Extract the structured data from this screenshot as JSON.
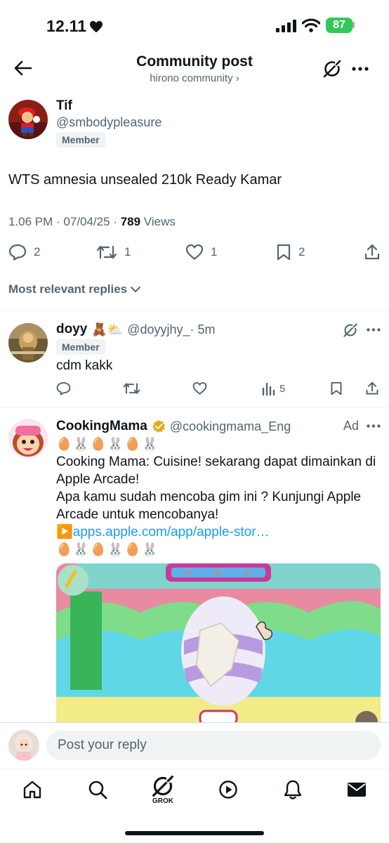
{
  "status_bar": {
    "time": "12.11",
    "battery": "87"
  },
  "header": {
    "title": "Community post",
    "subtitle": "hirono community ›"
  },
  "post": {
    "name": "Tif",
    "handle": "@smbodypleasure",
    "badge": "Member",
    "text": "WTS amnesia unsealed 210k Ready Kamar",
    "meta_time": "1.06 PM · 07/04/25 · ",
    "views_count": "789",
    "views_label": " Views",
    "replies": "2",
    "reposts": "1",
    "likes": "1",
    "bookmarks": "2"
  },
  "sort_label": "Most relevant replies",
  "reply": {
    "name": "doyy",
    "name_emoji": "🧸⛅",
    "handle": "@doyyjhy_",
    "time": " · 5m",
    "badge": "Member",
    "text": "cdm kakk",
    "views": "5"
  },
  "ad": {
    "name": "CookingMama",
    "handle": "@cookingmama_Eng",
    "ad_label": "Ad",
    "emoji_row": "🥚🐰🥚🐰🥚🐰",
    "line1": "Cooking Mama: Cuisine! sekarang dapat dimainkan di Apple Arcade!",
    "line2": "Apa kamu sudah mencoba gim ini ? Kunjungi Apple Arcade untuk mencobanya!",
    "link_emoji": "▶️",
    "link": "apps.apple.com/app/apple-stor…",
    "emoji_row2": "🥚🐰🥚🐰🥚🐰"
  },
  "reply_box": {
    "placeholder": "Post your reply"
  },
  "tab_bar": {
    "grok_label": "GROK"
  }
}
